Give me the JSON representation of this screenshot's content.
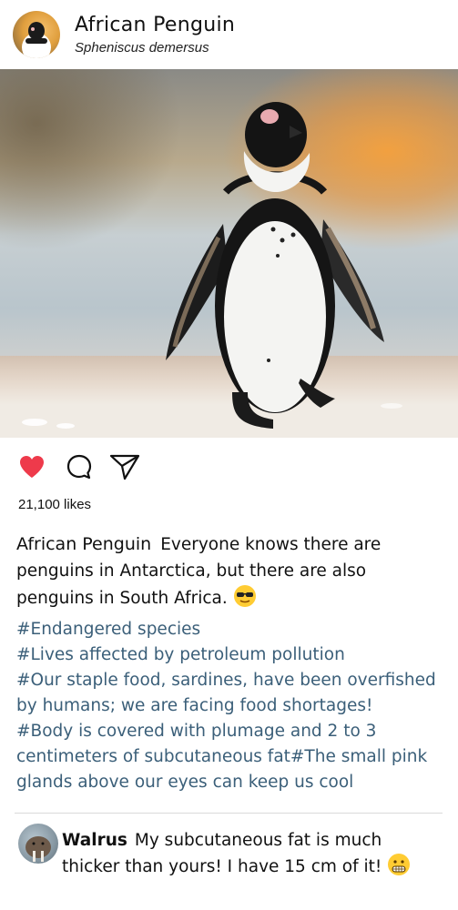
{
  "post": {
    "author_name": "African Penguin",
    "author_subtitle": "Spheniscus demersus",
    "likes": "21,100 likes",
    "caption": {
      "username": "African Penguin",
      "text": "Everyone knows there are penguins in Antarctica, but there are also penguins in South Africa.",
      "emoji": "sunglasses-emoji"
    },
    "hashtag_lines": [
      "#Endangered species",
      "#Lives affected by petroleum pollution",
      "#Our staple food, sardines, have been overfished",
      "by humans; we are facing food shortages!",
      "#Body is covered with plumage and 2 to 3",
      "centimeters of subcutaneous fat#The small pink",
      "glands above our eyes can keep us cool"
    ]
  },
  "actions": {
    "like_icon": "heart-icon",
    "comment_icon": "comment-icon",
    "share_icon": "send-icon",
    "liked": true
  },
  "comment": {
    "username": "Walrus",
    "text": "My subcutaneous fat is much thicker than yours! I have 15 cm of it!",
    "emoji": "grimace-emoji"
  },
  "colors": {
    "heart": "#ee3a4b",
    "hashtag": "#3b5f79",
    "divider": "#d9d9d9"
  }
}
